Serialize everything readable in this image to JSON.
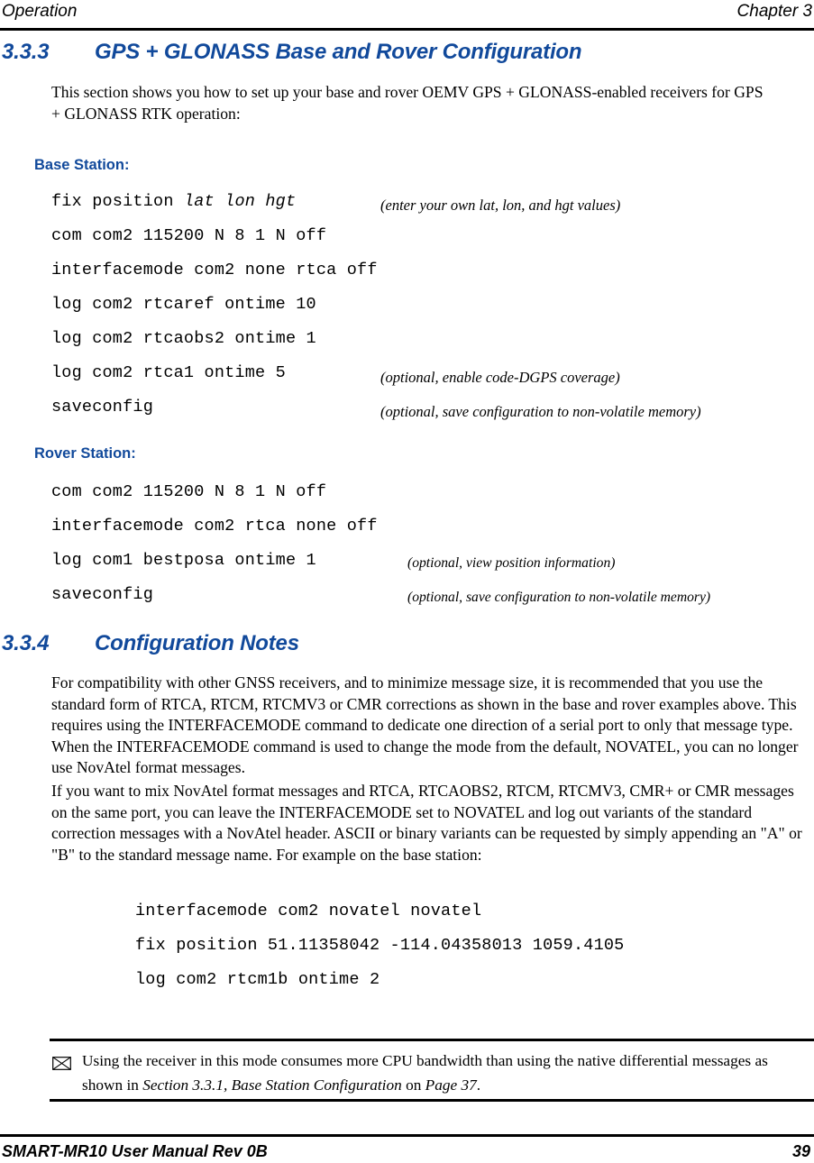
{
  "header": {
    "left": "Operation",
    "right": "Chapter 3"
  },
  "sections": {
    "s333": {
      "number": "3.3.3",
      "title": "GPS + GLONASS Base and Rover Configuration",
      "intro": "This section shows you how to set up your base and rover OEMV GPS + GLONASS-enabled receivers for GPS + GLONASS RTK operation:",
      "base_label": "Base Station:",
      "base_commands": [
        {
          "cmd_pre": "fix position ",
          "cmd_italic": "lat lon hgt",
          "cmd_post": "",
          "note": "(enter your own lat, lon, and hgt values)"
        },
        {
          "cmd_pre": "com com2 115200 N 8 1 N off",
          "cmd_italic": "",
          "cmd_post": "",
          "note": ""
        },
        {
          "cmd_pre": "interfacemode com2 none rtca off",
          "cmd_italic": "",
          "cmd_post": "",
          "note": ""
        },
        {
          "cmd_pre": "log com2 rtcaref ontime 10",
          "cmd_italic": "",
          "cmd_post": "",
          "note": ""
        },
        {
          "cmd_pre": "log com2 rtcaobs2 ontime 1",
          "cmd_italic": "",
          "cmd_post": "",
          "note": ""
        },
        {
          "cmd_pre": "log com2 rtca1 ontime 5",
          "cmd_italic": "",
          "cmd_post": "",
          "note": "(optional, enable code-DGPS coverage)"
        },
        {
          "cmd_pre": "saveconfig",
          "cmd_italic": "",
          "cmd_post": "",
          "note": "(optional, save configuration to non-volatile memory)"
        }
      ],
      "rover_label": "Rover Station:",
      "rover_commands": [
        {
          "cmd_pre": "com com2 115200 N 8 1 N off",
          "cmd_italic": "",
          "cmd_post": "",
          "note": ""
        },
        {
          "cmd_pre": "interfacemode com2 rtca none off",
          "cmd_italic": "",
          "cmd_post": "",
          "note": ""
        },
        {
          "cmd_pre": "log com1 bestposa ontime 1",
          "cmd_italic": "",
          "cmd_post": "",
          "note": "(optional, view position information)"
        },
        {
          "cmd_pre": "saveconfig",
          "cmd_italic": "",
          "cmd_post": "",
          "note": "(optional, save configuration to non-volatile memory)"
        }
      ]
    },
    "s334": {
      "number": "3.3.4",
      "title": "Configuration Notes",
      "para1": "For compatibility with other GNSS receivers, and to minimize message size, it is recommended that you use the standard form of RTCA, RTCM, RTCMV3 or CMR corrections as shown in the base and rover examples above. This requires using the INTERFACEMODE command to dedicate one direction of a serial port to only that message type. When the INTERFACEMODE command is used to change the mode from the default, NOVATEL, you can no longer use NovAtel format messages.",
      "para2": "If you want to mix NovAtel format messages and RTCA, RTCAOBS2, RTCM, RTCMV3, CMR+ or CMR messages on the same port, you can leave the INTERFACEMODE set to NOVATEL and log out variants of the standard correction messages with a NovAtel header. ASCII or binary variants can be requested by simply appending an \"A\" or \"B\" to the standard message name. For example on the base station:",
      "code_lines": [
        "interfacemode com2 novatel novatel",
        "fix position 51.11358042 -114.04358013 1059.4105",
        "log com2 rtcm1b ontime 2"
      ]
    }
  },
  "note": {
    "icon": "envelope-icon",
    "text_part1": "Using the receiver in this mode consumes more CPU bandwidth than using the native differential messages as shown in ",
    "text_italic1": "Section 3.3.1, Base Station Configuration",
    "text_part2": " on ",
    "text_italic2": "Page 37",
    "text_part3": "."
  },
  "footer": {
    "left": "SMART-MR10 User Manual Rev 0B",
    "right": "39"
  },
  "colors": {
    "heading_blue": "#11499b",
    "text_black": "#000000",
    "page_background": "#ffffff"
  }
}
